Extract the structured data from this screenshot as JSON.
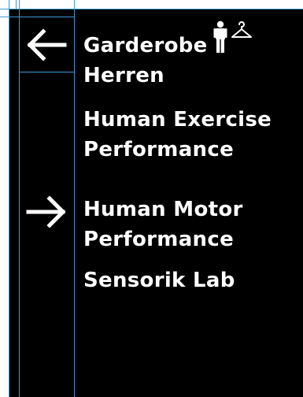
{
  "entries": [
    {
      "lines": [
        "Garderobe",
        "Herren"
      ],
      "arrow": "left",
      "icon": "person-with-coat-hanger-icon"
    },
    {
      "lines": [
        "Human Exercise",
        "Performance"
      ],
      "arrow": null
    },
    {
      "lines": [
        "Human Motor",
        "Performance"
      ],
      "arrow": "right"
    },
    {
      "lines": [
        "Sensorik Lab"
      ],
      "arrow": null
    }
  ],
  "colors": {
    "background": "#000000",
    "text": "#ffffff",
    "guides": "#3a9ad9"
  }
}
